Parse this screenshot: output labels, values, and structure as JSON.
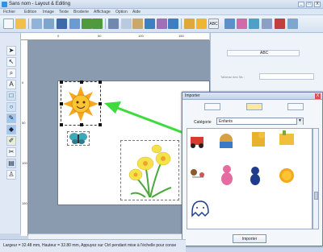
{
  "window": {
    "title": "Sans nom - Layout & Editing",
    "controls": [
      "_",
      "□",
      "X"
    ]
  },
  "menu": [
    "Fichier",
    "Edition",
    "Image",
    "Texte",
    "Broderie",
    "Affichage",
    "Option",
    "Aide"
  ],
  "toolbar": {
    "icons": [
      "new-icon",
      "open-icon",
      "template-icon",
      "import-icon",
      "save-icon",
      "wireless-icon",
      "undo-icon",
      "redo-icon",
      "cut-icon",
      "copy-icon",
      "paste-icon",
      "fill-icon",
      "mirror-icon",
      "rotate-icon",
      "pen-icon",
      "stitch-icon",
      "abc-icon",
      "text-icon",
      "grid-icon",
      "view-icon",
      "preview-icon",
      "help-icon"
    ]
  },
  "tools": [
    "arrow-tool",
    "point-tool",
    "zoom-tool",
    "text-tool",
    "shape-tool",
    "circle-tool",
    "brush-tool",
    "fill-tool",
    "pipette-tool",
    "eraser-tool",
    "stitch-tool",
    "figure-tool"
  ],
  "ruler": {
    "h": [
      "0",
      "50",
      "100",
      "150"
    ],
    "v": [
      "0",
      "50",
      "100",
      "150"
    ]
  },
  "right_panel": {
    "abc": "ABC",
    "tableau_label": "Tableau des fils :"
  },
  "dialog": {
    "title": "Importer",
    "category_label": "Catégorie",
    "category_value": "Enfants",
    "import_button": "Importer",
    "close": "X"
  },
  "status": {
    "text": "Largeur = 32.48 mm, Hauteur = 32.80 mm, Appuyez sur Ctrl pendant mise à l'échelle pour conse"
  },
  "colors": {
    "accent": "#3ddc3d",
    "sun": "#f6a71c",
    "daffodil": "#f5e24a",
    "stem": "#4ca83a"
  }
}
